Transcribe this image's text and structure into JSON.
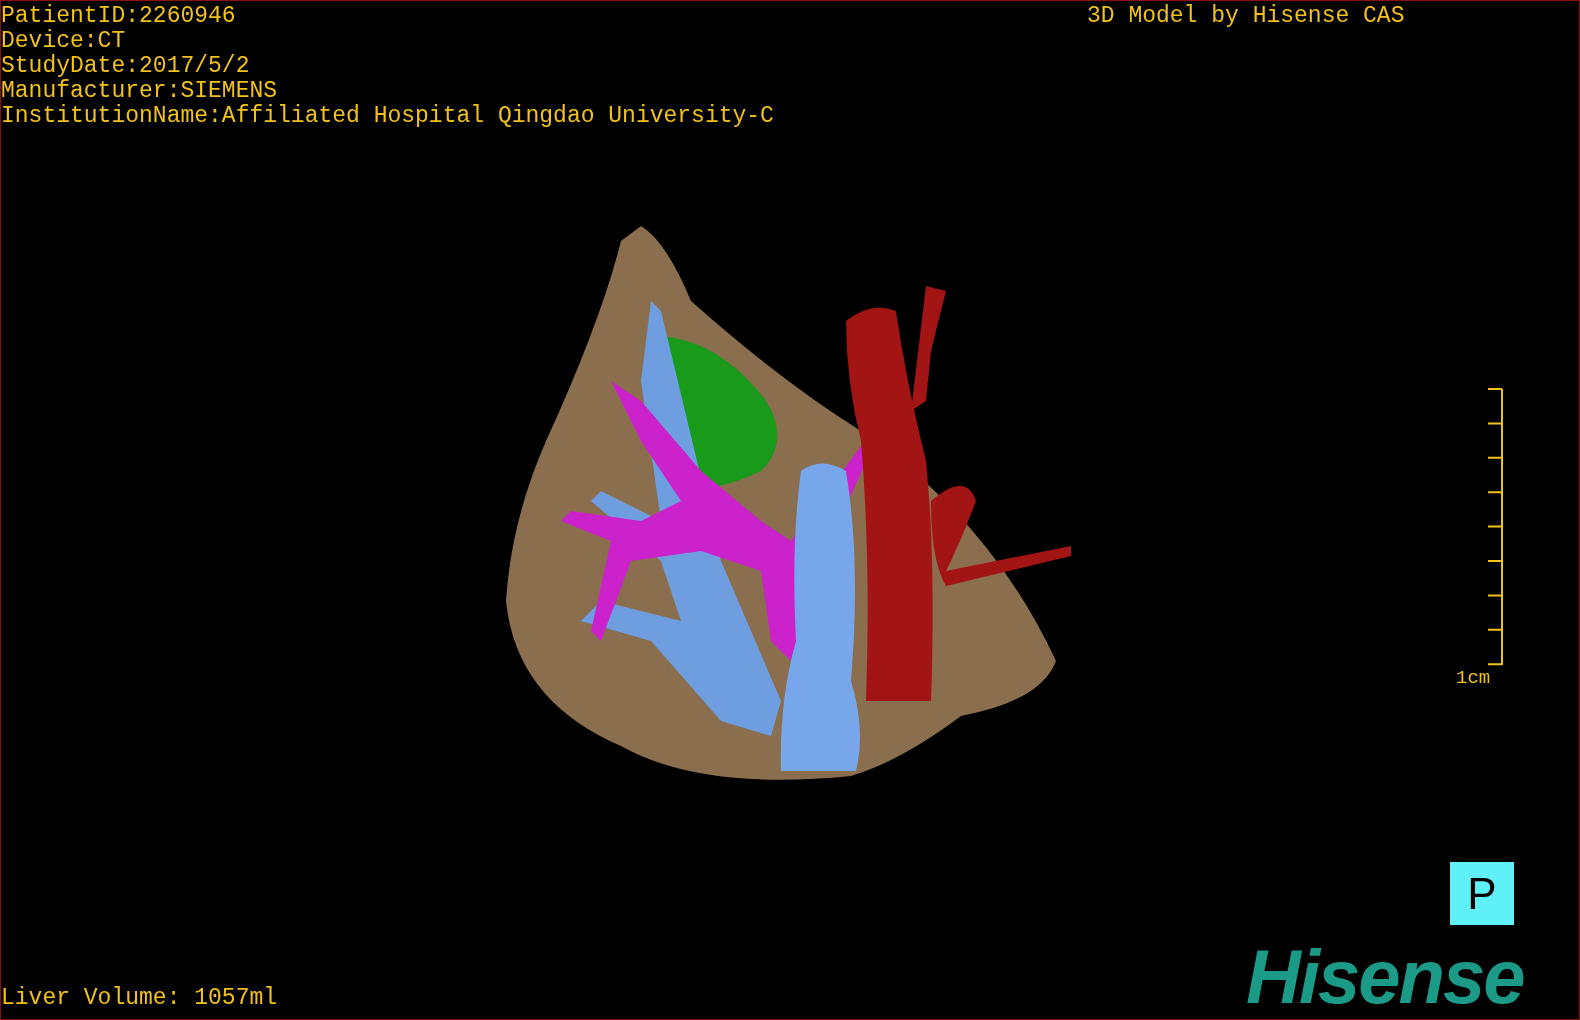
{
  "info_lines": [
    "PatientID:2260946",
    "Device:CT",
    "StudyDate:2017/5/2",
    "Manufacturer:SIEMENS",
    "InstitutionName:Affiliated Hospital Qingdao University-C"
  ],
  "title": "3D Model by Hisense CAS",
  "scale_bar": {
    "label": "1cm"
  },
  "view_button": {
    "label": "P"
  },
  "logo": "Hisense",
  "liver_volume": "Liver Volume: 1057ml"
}
